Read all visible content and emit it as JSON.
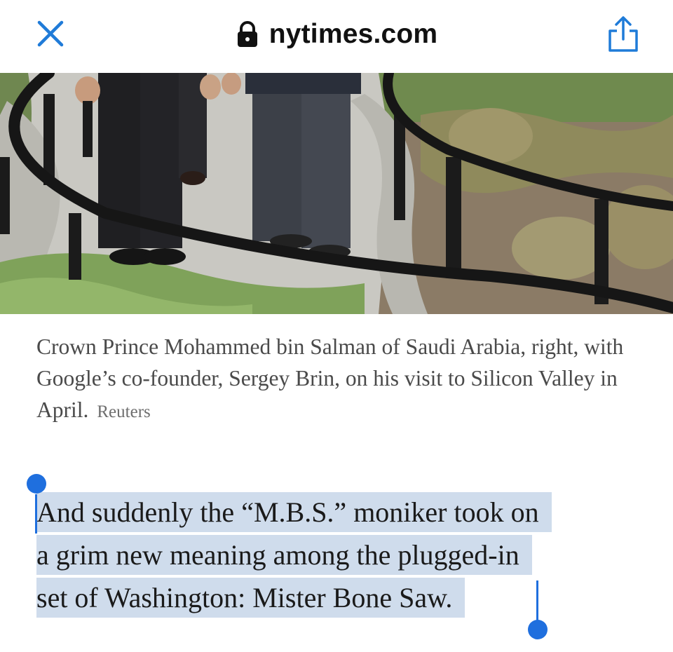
{
  "browser": {
    "url": "nytimes.com",
    "accent_color": "#1f7bd8",
    "icons": {
      "close": "close-icon",
      "lock": "lock-icon",
      "share": "share-icon"
    }
  },
  "article": {
    "photo": {
      "description_icon": "photo"
    },
    "caption": {
      "text": "Crown Prince Mohammed bin Salman of Saudi Arabia, right, with Google’s co-founder, Sergey Brin, on his visit to Silicon Valley in April.",
      "credit": "Reuters"
    },
    "paragraph": {
      "lines": [
        "And suddenly the “M.B.S.” moniker took on",
        "a grim new meaning among the plugged-in",
        "set of Washington: Mister Bone Saw."
      ],
      "selection_color": "#cfdcec",
      "selection_handle_color": "#1f6fde"
    }
  }
}
